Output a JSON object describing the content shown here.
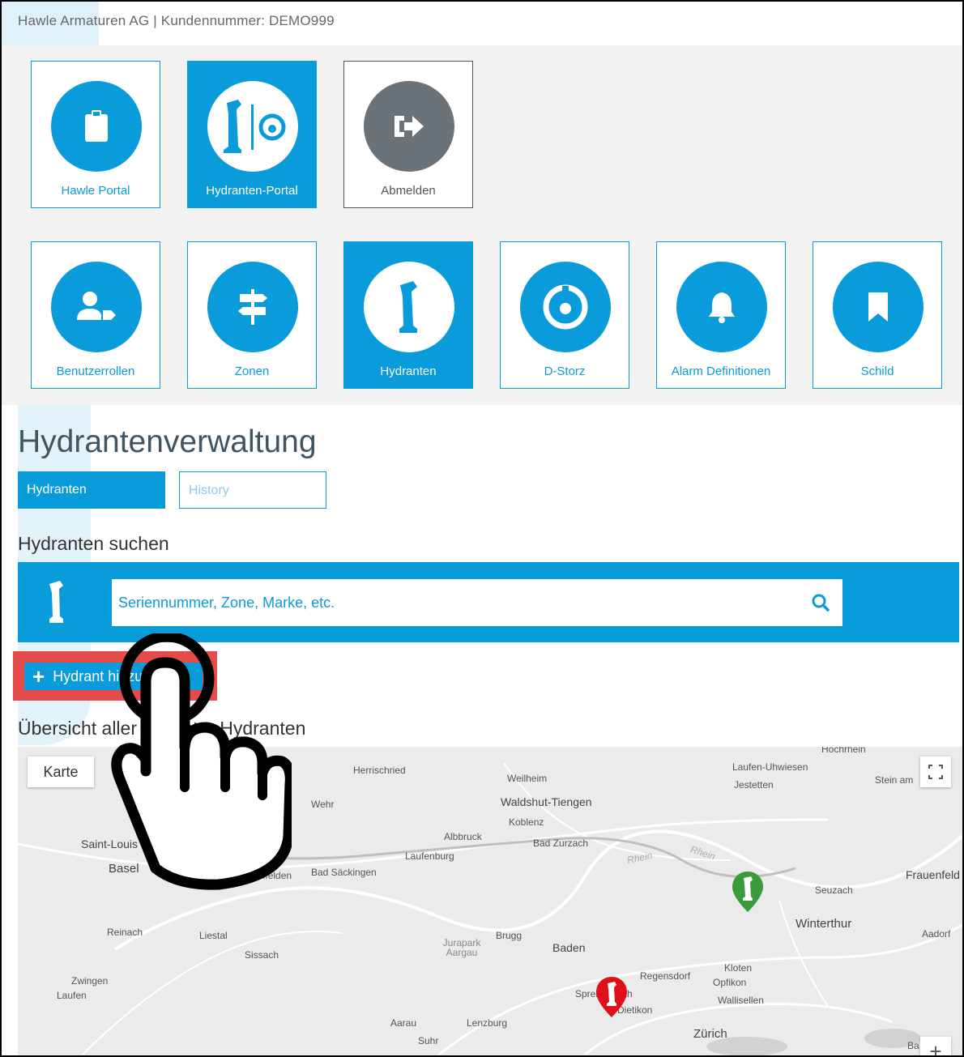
{
  "header": {
    "company_text": "Hawle Armaturen AG | Kundennummer: DEMO999"
  },
  "top_tiles": [
    {
      "label": "Hawle Portal",
      "icon": "clipboard-icon",
      "active": false
    },
    {
      "label": "Hydranten-Portal",
      "icon": "hydrant-portal-icon",
      "active": true
    },
    {
      "label": "Abmelden",
      "icon": "logout-icon",
      "active": false
    }
  ],
  "sub_tiles": [
    {
      "label": "Benutzerrollen",
      "icon": "user-tag-icon",
      "active": false
    },
    {
      "label": "Zonen",
      "icon": "signpost-icon",
      "active": false
    },
    {
      "label": "Hydranten",
      "icon": "hydrant-icon",
      "active": true
    },
    {
      "label": "D-Storz",
      "icon": "d-storz-icon",
      "active": false
    },
    {
      "label": "Alarm Definitionen",
      "icon": "bell-icon",
      "active": false
    },
    {
      "label": "Schild",
      "icon": "bookmark-icon",
      "active": false
    }
  ],
  "page_title": "Hydrantenverwaltung",
  "tabs": [
    {
      "label": "Hydranten",
      "active": true
    },
    {
      "label": "History",
      "active": false
    }
  ],
  "search": {
    "heading": "Hydranten suchen",
    "placeholder": "Seriennummer, Zone, Marke, etc.",
    "value": ""
  },
  "add_button": {
    "label": "Hydrant hinzufügen"
  },
  "map": {
    "heading": "Übersicht aller erfasster Hydranten",
    "map_type_label": "Karte",
    "zoom_in_label": "+",
    "places": [
      "Herrischried",
      "Weilheim",
      "Laufen-Uhwiesen",
      "Jestetten",
      "Stein am",
      "Hochrhein",
      "Wehr",
      "Waldshut-Tiengen",
      "Koblenz",
      "Albbruck",
      "Bad Zurzach",
      "Saint-Louis",
      "Laufenburg",
      "Rhein",
      "Rhein",
      "Basel",
      "Rheinfelden",
      "Bad Säckingen",
      "Frauenfeld",
      "Seuzach",
      "Winterthur",
      "Aadorf",
      "Reinach",
      "Liestal",
      "Sissach",
      "Jurapark Aargau",
      "Brugg",
      "Baden",
      "Kloten",
      "Regensdorf",
      "Opfikon",
      "Wallisellen",
      "Zwingen",
      "Laufen",
      "Spreitenbach",
      "Dietikon",
      "Aarau",
      "Lenzburg",
      "Zürich",
      "Suhr",
      "Ba"
    ],
    "markers": [
      {
        "label": "1",
        "color": "#3b9b3b"
      },
      {
        "label": "1",
        "color": "#e0101a"
      }
    ],
    "colors": {
      "accent": "#0a9bdb",
      "highlight": "#e54b4b",
      "grey": "#6b7378"
    }
  }
}
